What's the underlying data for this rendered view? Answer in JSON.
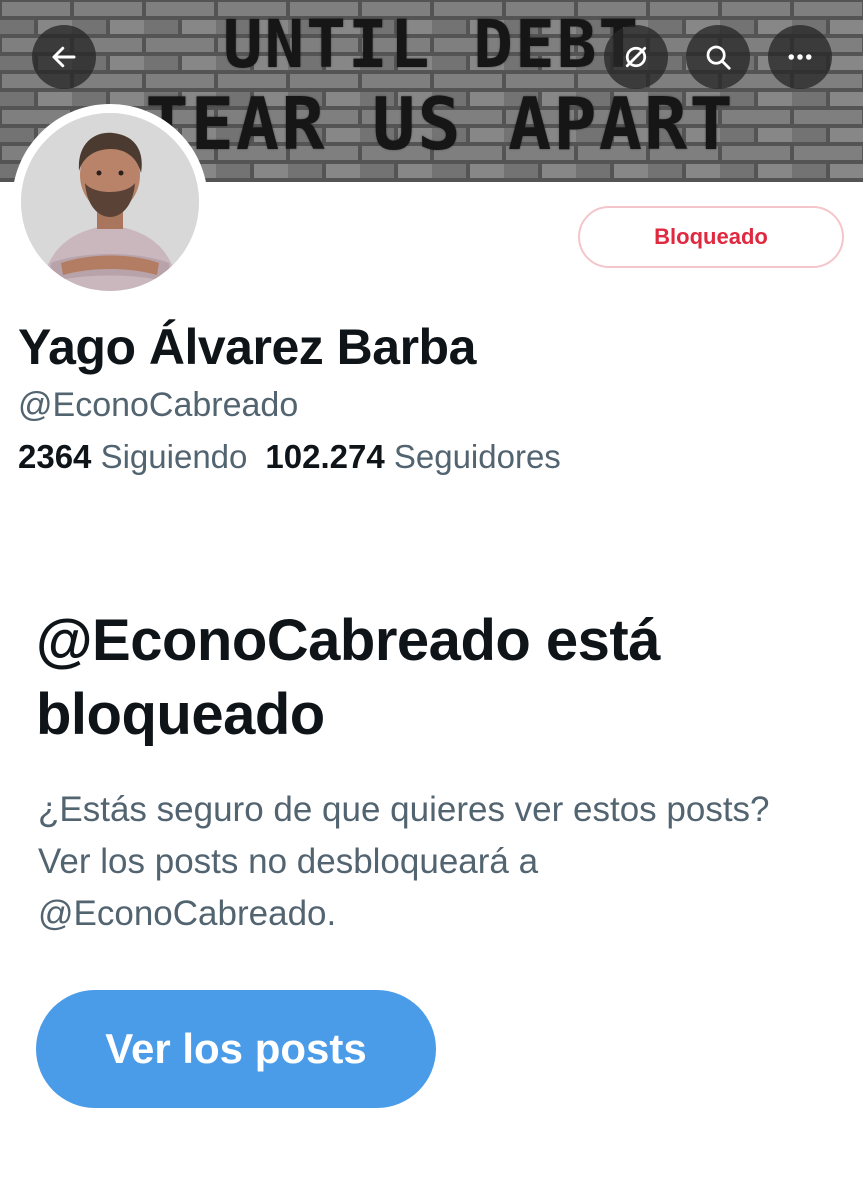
{
  "banner": {
    "line1": "UNTIL DEBT",
    "line2": "TEAR US APART"
  },
  "header": {
    "back_icon": "arrow-left-icon",
    "notify_icon": "bell-off-icon",
    "search_icon": "search-icon",
    "more_icon": "more-horizontal-icon"
  },
  "profile": {
    "display_name": "Yago Álvarez Barba",
    "handle": "@EconoCabreado",
    "following_count": "2364",
    "following_label": "Siguiendo",
    "followers_count": "102.274",
    "followers_label": "Seguidores",
    "blocked_button_label": "Bloqueado"
  },
  "blocked_notice": {
    "title": "@EconoCabreado está bloqueado",
    "description": "¿Estás seguro de que quieres ver estos posts? Ver los posts no desbloqueará a @EconoCabreado.",
    "button_label": "Ver los posts"
  },
  "colors": {
    "text_primary": "#0f1419",
    "text_secondary": "#536471",
    "blocked_red": "#e0283f",
    "button_blue": "#4a9ce8"
  }
}
